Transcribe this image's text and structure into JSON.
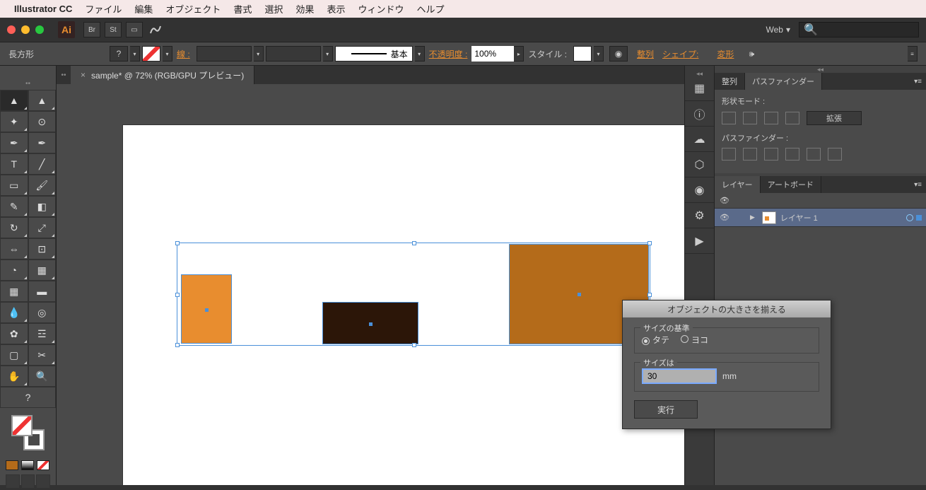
{
  "menubar": {
    "app_name": "Illustrator CC",
    "items": [
      "ファイル",
      "編集",
      "オブジェクト",
      "書式",
      "選択",
      "効果",
      "表示",
      "ウィンドウ",
      "ヘルプ"
    ]
  },
  "window": {
    "workspace": "Web",
    "search_placeholder": ""
  },
  "controlbar": {
    "tool_name": "長方形",
    "stroke_label": "線 :",
    "style_basic": "基本",
    "opacity_label": "不透明度 :",
    "opacity_value": "100%",
    "style_label": "スタイル :",
    "align_label": "整列",
    "shape_label": "シェイプ:",
    "transform_label": "変形"
  },
  "document": {
    "tab_title": "sample* @ 72% (RGB/GPU プレビュー)"
  },
  "pathfinder_panel": {
    "tab_align": "整列",
    "tab_pathfinder": "パスファインダー",
    "shape_mode_label": "形状モード :",
    "expand_label": "拡張",
    "pathfinder_label": "パスファインダー :"
  },
  "layers_panel": {
    "tab_layers": "レイヤー",
    "tab_artboards": "アートボード",
    "layer1_name": "レイヤー 1"
  },
  "dialog": {
    "title": "オブジェクトの大きさを揃える",
    "size_basis_label": "サイズの基準",
    "radio_vertical": "タテ",
    "radio_horizontal": "ヨコ",
    "size_label": "サイズは",
    "size_value": "30",
    "size_unit": "mm",
    "execute_label": "実行"
  },
  "shapes": {
    "rect1": {
      "color": "#e88d2f"
    },
    "rect2": {
      "color": "#2c1608"
    },
    "rect3": {
      "color": "#b46b1a"
    }
  }
}
